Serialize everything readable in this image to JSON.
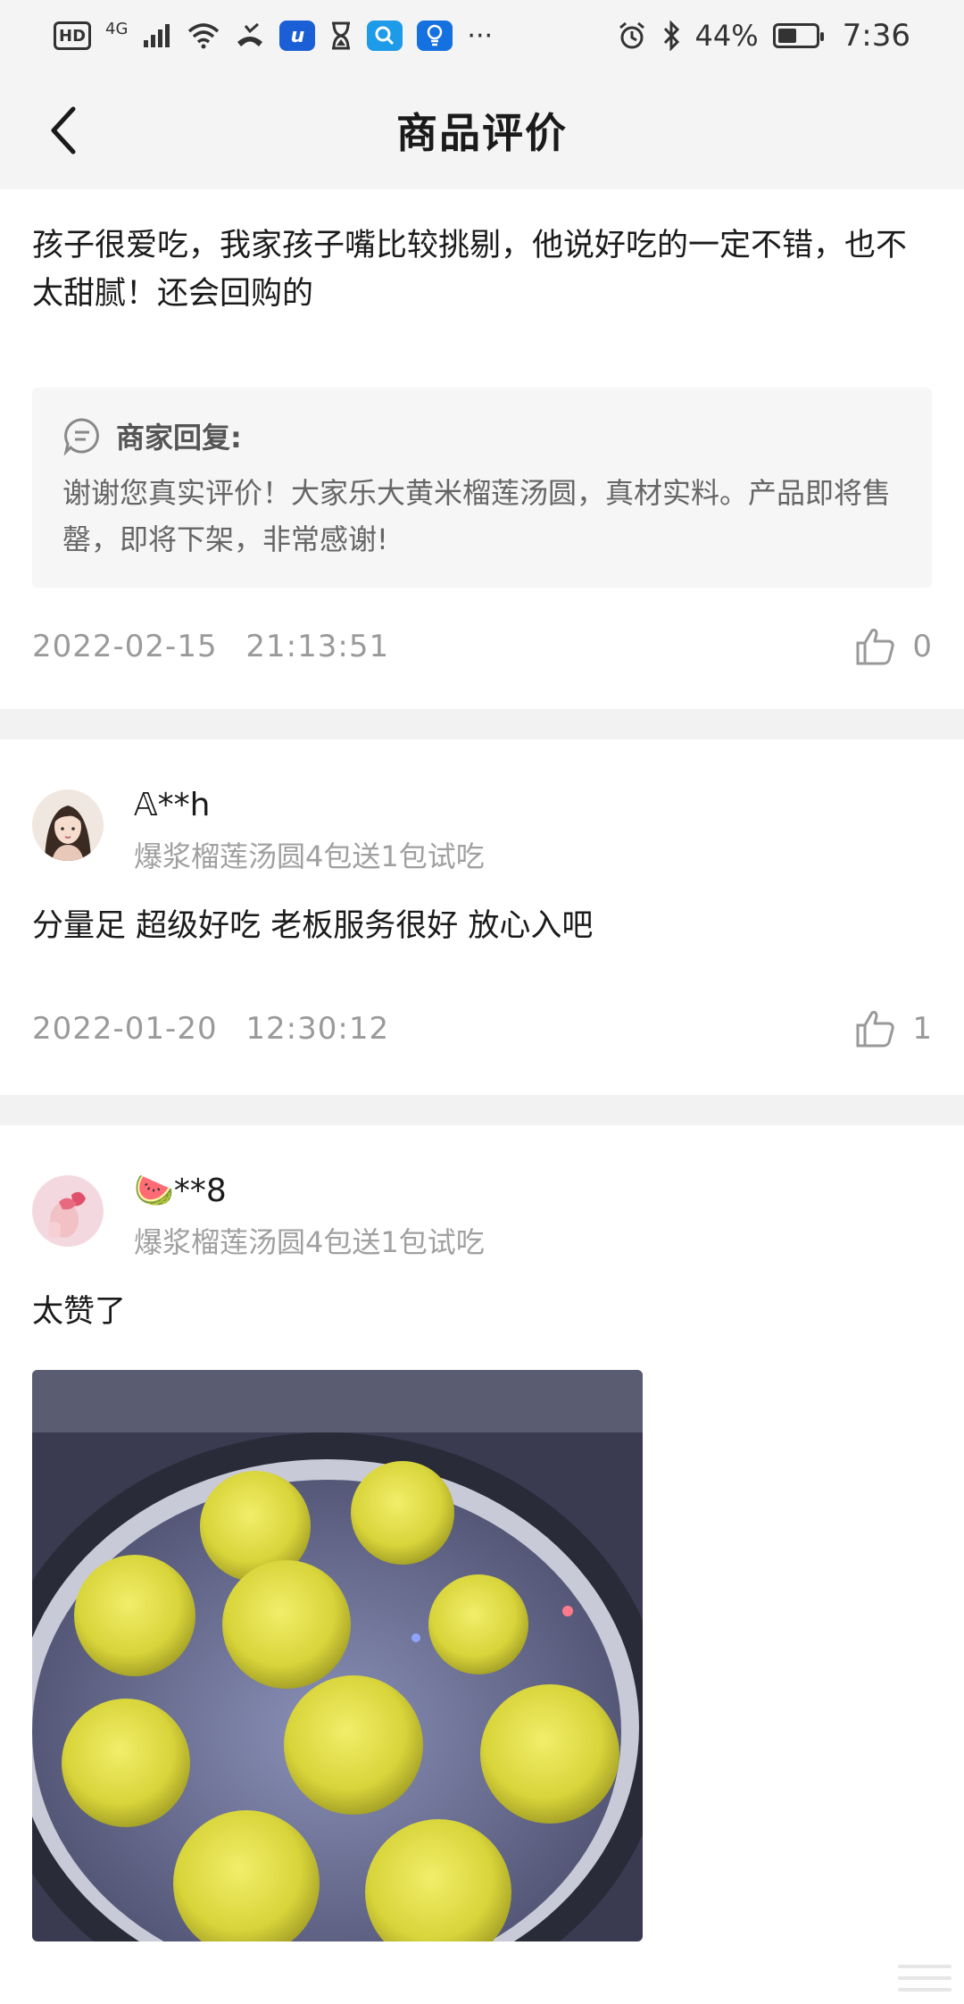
{
  "status": {
    "network": "4G",
    "battery": "44%",
    "time": "7:36",
    "more": "···"
  },
  "header": {
    "title": "商品评价"
  },
  "reviews": [
    {
      "text": "孩子很爱吃，我家孩子嘴比较挑剔，他说好吃的一定不错，也不太甜腻！还会回购的",
      "reply_label": "商家回复:",
      "reply_text": "谢谢您真实评价！大家乐大黄米榴莲汤圆，真材实料。产品即将售罄，即将下架，非常感谢!",
      "date": "2022-02-15",
      "time": "21:13:51",
      "likes": "0"
    },
    {
      "user": "𝔸**h",
      "spec": "爆浆榴莲汤圆4包送1包试吃",
      "text": "分量足 超级好吃 老板服务很好 放心入吧",
      "date": "2022-01-20",
      "time": "12:30:12",
      "likes": "1"
    },
    {
      "user": "🍉**8",
      "spec": "爆浆榴莲汤圆4包送1包试吃",
      "text": "太赞了"
    }
  ],
  "colors": {
    "bar_bg": "#f4f4f4",
    "muted": "#9a9a9a",
    "reply_bg": "#f6f6f6"
  }
}
